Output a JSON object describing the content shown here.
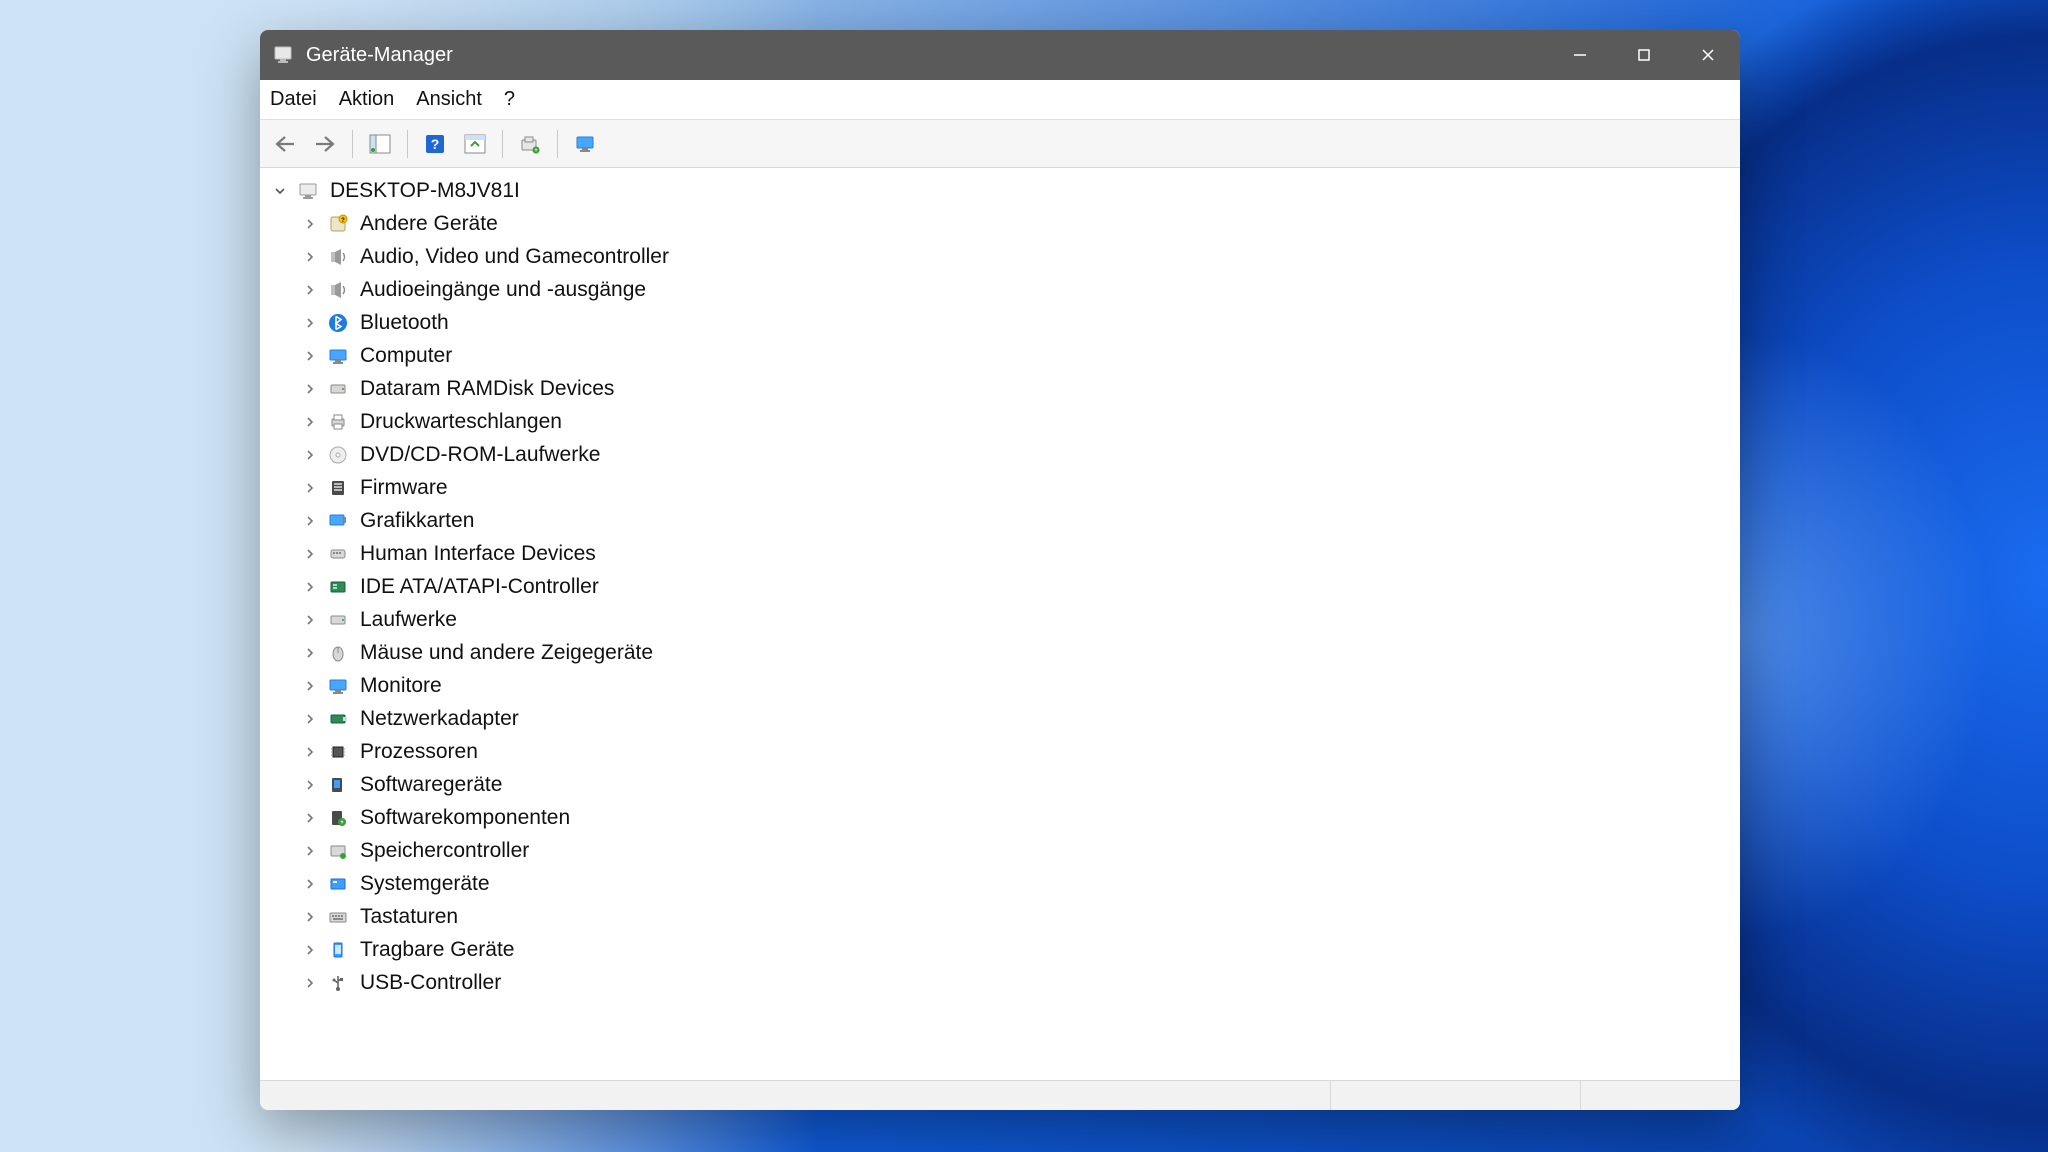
{
  "window": {
    "title": "Geräte-Manager"
  },
  "menu": {
    "file": "Datei",
    "action": "Aktion",
    "view": "Ansicht",
    "help": "?"
  },
  "tree": {
    "root": "DESKTOP-M8JV81I",
    "items": [
      {
        "label": "Andere Geräte",
        "icon": "other-devices"
      },
      {
        "label": "Audio, Video und Gamecontroller",
        "icon": "audio"
      },
      {
        "label": "Audioeingänge und -ausgänge",
        "icon": "audio"
      },
      {
        "label": "Bluetooth",
        "icon": "bluetooth"
      },
      {
        "label": "Computer",
        "icon": "computer"
      },
      {
        "label": "Dataram RAMDisk Devices",
        "icon": "disk"
      },
      {
        "label": "Druckwarteschlangen",
        "icon": "printer"
      },
      {
        "label": "DVD/CD-ROM-Laufwerke",
        "icon": "disc"
      },
      {
        "label": "Firmware",
        "icon": "firmware"
      },
      {
        "label": "Grafikkarten",
        "icon": "display-adapter"
      },
      {
        "label": "Human Interface Devices",
        "icon": "hid"
      },
      {
        "label": "IDE ATA/ATAPI-Controller",
        "icon": "controller"
      },
      {
        "label": "Laufwerke",
        "icon": "disk"
      },
      {
        "label": "Mäuse und andere Zeigegeräte",
        "icon": "mouse"
      },
      {
        "label": "Monitore",
        "icon": "monitor"
      },
      {
        "label": "Netzwerkadapter",
        "icon": "network"
      },
      {
        "label": "Prozessoren",
        "icon": "processor"
      },
      {
        "label": "Softwaregeräte",
        "icon": "software-device"
      },
      {
        "label": "Softwarekomponenten",
        "icon": "software-component"
      },
      {
        "label": "Speichercontroller",
        "icon": "storage-controller"
      },
      {
        "label": "Systemgeräte",
        "icon": "system"
      },
      {
        "label": "Tastaturen",
        "icon": "keyboard"
      },
      {
        "label": "Tragbare Geräte",
        "icon": "portable"
      },
      {
        "label": "USB-Controller",
        "icon": "usb"
      }
    ]
  }
}
